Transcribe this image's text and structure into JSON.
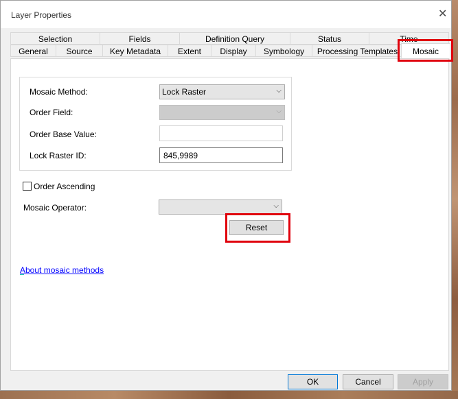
{
  "window": {
    "title": "Layer Properties",
    "close_icon": "close-icon"
  },
  "tabs": {
    "row1": [
      "Selection",
      "Fields",
      "Definition Query",
      "Status",
      "Time"
    ],
    "row2": [
      "General",
      "Source",
      "Key Metadata",
      "Extent",
      "Display",
      "Symbology",
      "Processing Templates",
      "Mosaic"
    ],
    "active": "Mosaic"
  },
  "mosaic": {
    "method_label": "Mosaic Method:",
    "method_value": "Lock Raster",
    "order_field_label": "Order Field:",
    "order_field_value": "",
    "order_base_label": "Order Base Value:",
    "order_base_value": "",
    "lock_raster_label": "Lock Raster ID:",
    "lock_raster_value": "845,9989",
    "order_ascending_label": "Order Ascending",
    "order_ascending_checked": false,
    "operator_label": "Mosaic Operator:",
    "operator_value": "",
    "reset_label": "Reset",
    "about_link": "About mosaic methods"
  },
  "footer": {
    "ok": "OK",
    "cancel": "Cancel",
    "apply": "Apply"
  },
  "colors": {
    "highlight": "#e0000c",
    "link": "#0000ff",
    "accent": "#0078d7"
  }
}
